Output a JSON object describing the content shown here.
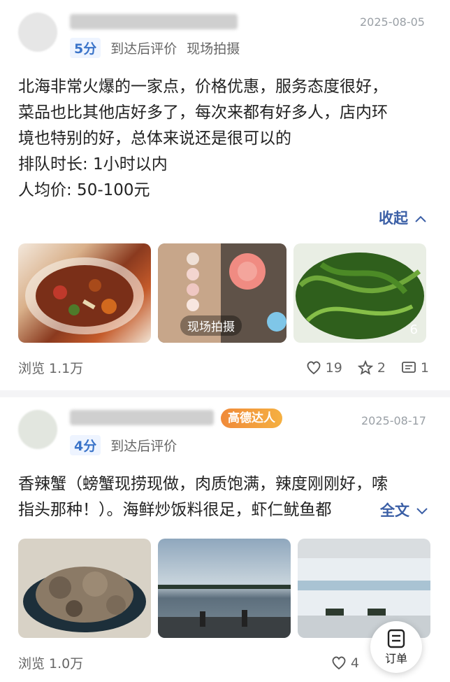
{
  "reviews": [
    {
      "date": "2025-08-05",
      "score": "5分",
      "tags": [
        "到达后评价",
        "现场拍摄"
      ],
      "content_lines": [
        "北海非常火爆的一家点，价格优惠，服务态度很好，",
        "菜品也比其他店好多了，每次来都有好多人，店内环",
        "境也特别的好，总体来说还是很可以的",
        "排队时长: 1小时以内",
        "人均价: 50-100元"
      ],
      "collapse_label": "收起",
      "photo_overlay": "现场拍摄",
      "photo_count": "6",
      "views": "浏览 1.1万",
      "likes": "19",
      "favorites": "2",
      "comments": "1"
    },
    {
      "date": "2025-08-17",
      "score": "4分",
      "badge": "高德达人",
      "tags": [
        "到达后评价"
      ],
      "content_lines": [
        "香辣蟹（螃蟹现捞现做，肉质饱满，辣度刚刚好，嗦",
        "指头那种！）。海鲜炒饭料很足，虾仁鱿鱼都"
      ],
      "expand_label": "全文",
      "views": "浏览 1.0万",
      "likes": "4"
    }
  ],
  "fab_label": "订单"
}
